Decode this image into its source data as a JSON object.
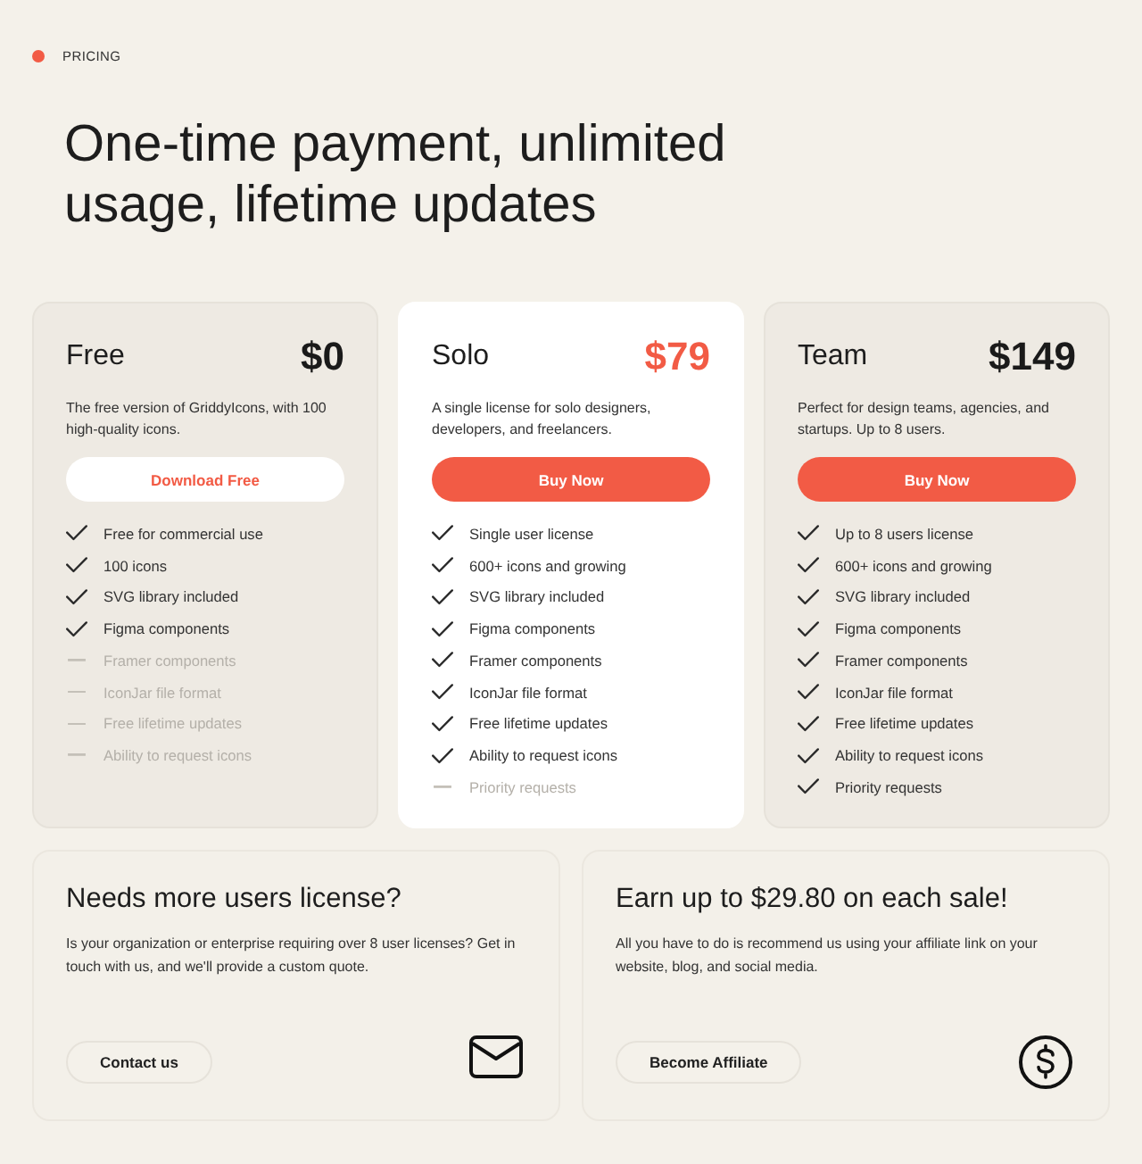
{
  "section_label": {
    "text": "PRICING"
  },
  "heading": "One-time payment, unlimited usage, lifetime updates",
  "plans": [
    {
      "name": "Free",
      "price": "$0",
      "featured": false,
      "description": "The free version of GriddyIcons, with 100 high-quality icons.",
      "button": {
        "label": "Download Free",
        "kind": "outline"
      },
      "features": [
        {
          "text": "Free for commercial use",
          "included": true
        },
        {
          "text": "100 icons",
          "included": true
        },
        {
          "text": "SVG library included",
          "included": true
        },
        {
          "text": "Figma components",
          "included": true
        },
        {
          "text": "Framer components",
          "included": false
        },
        {
          "text": "IconJar file format",
          "included": false
        },
        {
          "text": "Free lifetime updates",
          "included": false
        },
        {
          "text": "Ability to request icons",
          "included": false
        }
      ]
    },
    {
      "name": "Solo",
      "price": "$79",
      "featured": true,
      "description": "A single license for solo designers, developers, and freelancers.",
      "button": {
        "label": "Buy Now",
        "kind": "solid"
      },
      "features": [
        {
          "text": "Single user license",
          "included": true
        },
        {
          "text": "600+ icons and growing",
          "included": true
        },
        {
          "text": "SVG library included",
          "included": true
        },
        {
          "text": "Figma components",
          "included": true
        },
        {
          "text": "Framer components",
          "included": true
        },
        {
          "text": "IconJar file format",
          "included": true
        },
        {
          "text": "Free lifetime updates",
          "included": true
        },
        {
          "text": "Ability to request icons",
          "included": true
        },
        {
          "text": "Priority requests",
          "included": false
        }
      ]
    },
    {
      "name": "Team",
      "price": "$149",
      "featured": false,
      "description": "Perfect for design teams, agencies, and startups. Up to 8 users.",
      "button": {
        "label": "Buy Now",
        "kind": "solid"
      },
      "features": [
        {
          "text": "Up to 8 users license",
          "included": true
        },
        {
          "text": "600+ icons and growing",
          "included": true
        },
        {
          "text": "SVG library included",
          "included": true
        },
        {
          "text": "Figma components",
          "included": true
        },
        {
          "text": "Framer components",
          "included": true
        },
        {
          "text": "IconJar file format",
          "included": true
        },
        {
          "text": "Free lifetime updates",
          "included": true
        },
        {
          "text": "Ability to request icons",
          "included": true
        },
        {
          "text": "Priority requests",
          "included": true
        }
      ]
    }
  ],
  "extras": [
    {
      "title": "Needs more users license?",
      "text": "Is your organization or enterprise requiring over 8 user licenses? Get in touch with us, and we'll provide a custom quote.",
      "button": "Contact us"
    },
    {
      "title": "Earn up to $29.80 on each sale!",
      "text": "All you have to do is recommend us using your affiliate link on your website, blog, and social media.",
      "button": "Become Affiliate"
    }
  ]
}
